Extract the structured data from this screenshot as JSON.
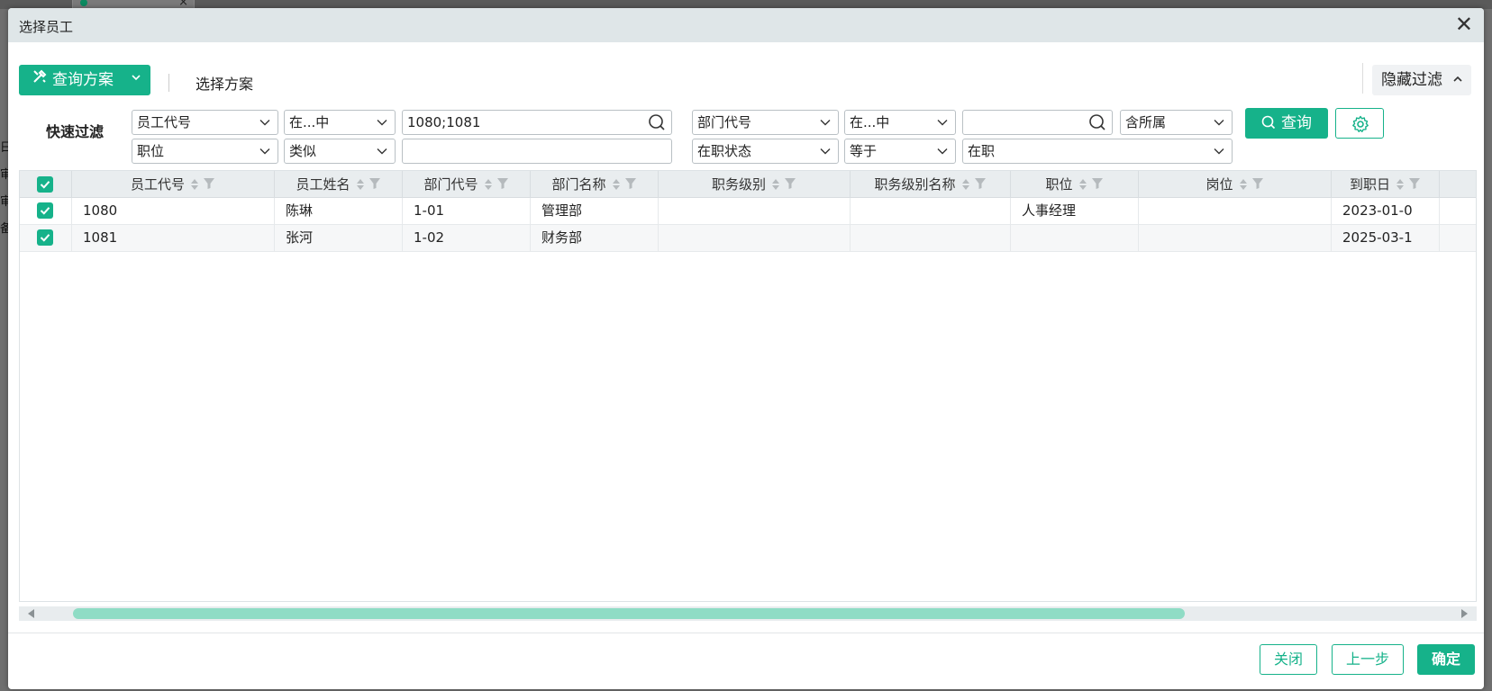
{
  "background": {
    "tab_close": "×",
    "side_chars": [
      "日",
      "审",
      "审",
      "备"
    ]
  },
  "dialog": {
    "title": "选择员工",
    "close_glyph": "✕"
  },
  "toolbar": {
    "scheme_button": "查询方案",
    "scheme_link": "选择方案",
    "hide_filter": "隐藏过滤"
  },
  "filter": {
    "label": "快速过滤",
    "row1": {
      "field1": "员工代号",
      "op1": "在...中",
      "value1": "1080;1081",
      "field2": "部门代号",
      "op2": "在...中",
      "value2": "",
      "scope": "含所属"
    },
    "row2": {
      "field1": "职位",
      "op1": "类似",
      "value1": "",
      "field2": "在职状态",
      "op2": "等于",
      "value2": "在职"
    },
    "query_button": "查询"
  },
  "table": {
    "columns": [
      "员工代号",
      "员工姓名",
      "部门代号",
      "部门名称",
      "职务级别",
      "职务级别名称",
      "职位",
      "岗位",
      "到职日"
    ],
    "rows": [
      {
        "checked": true,
        "cells": [
          "1080",
          "陈琳",
          "1-01",
          "管理部",
          "",
          "",
          "人事经理",
          "",
          "2023-01-0"
        ]
      },
      {
        "checked": true,
        "cells": [
          "1081",
          "张河",
          "1-02",
          "财务部",
          "",
          "",
          "",
          "",
          "2025-03-1"
        ]
      }
    ]
  },
  "footer": {
    "close": "关闭",
    "prev": "上一步",
    "confirm": "确定"
  },
  "colors": {
    "accent": "#16b28a",
    "header_bg": "#dfe6e8",
    "scroll_thumb": "#8fdcc5"
  }
}
